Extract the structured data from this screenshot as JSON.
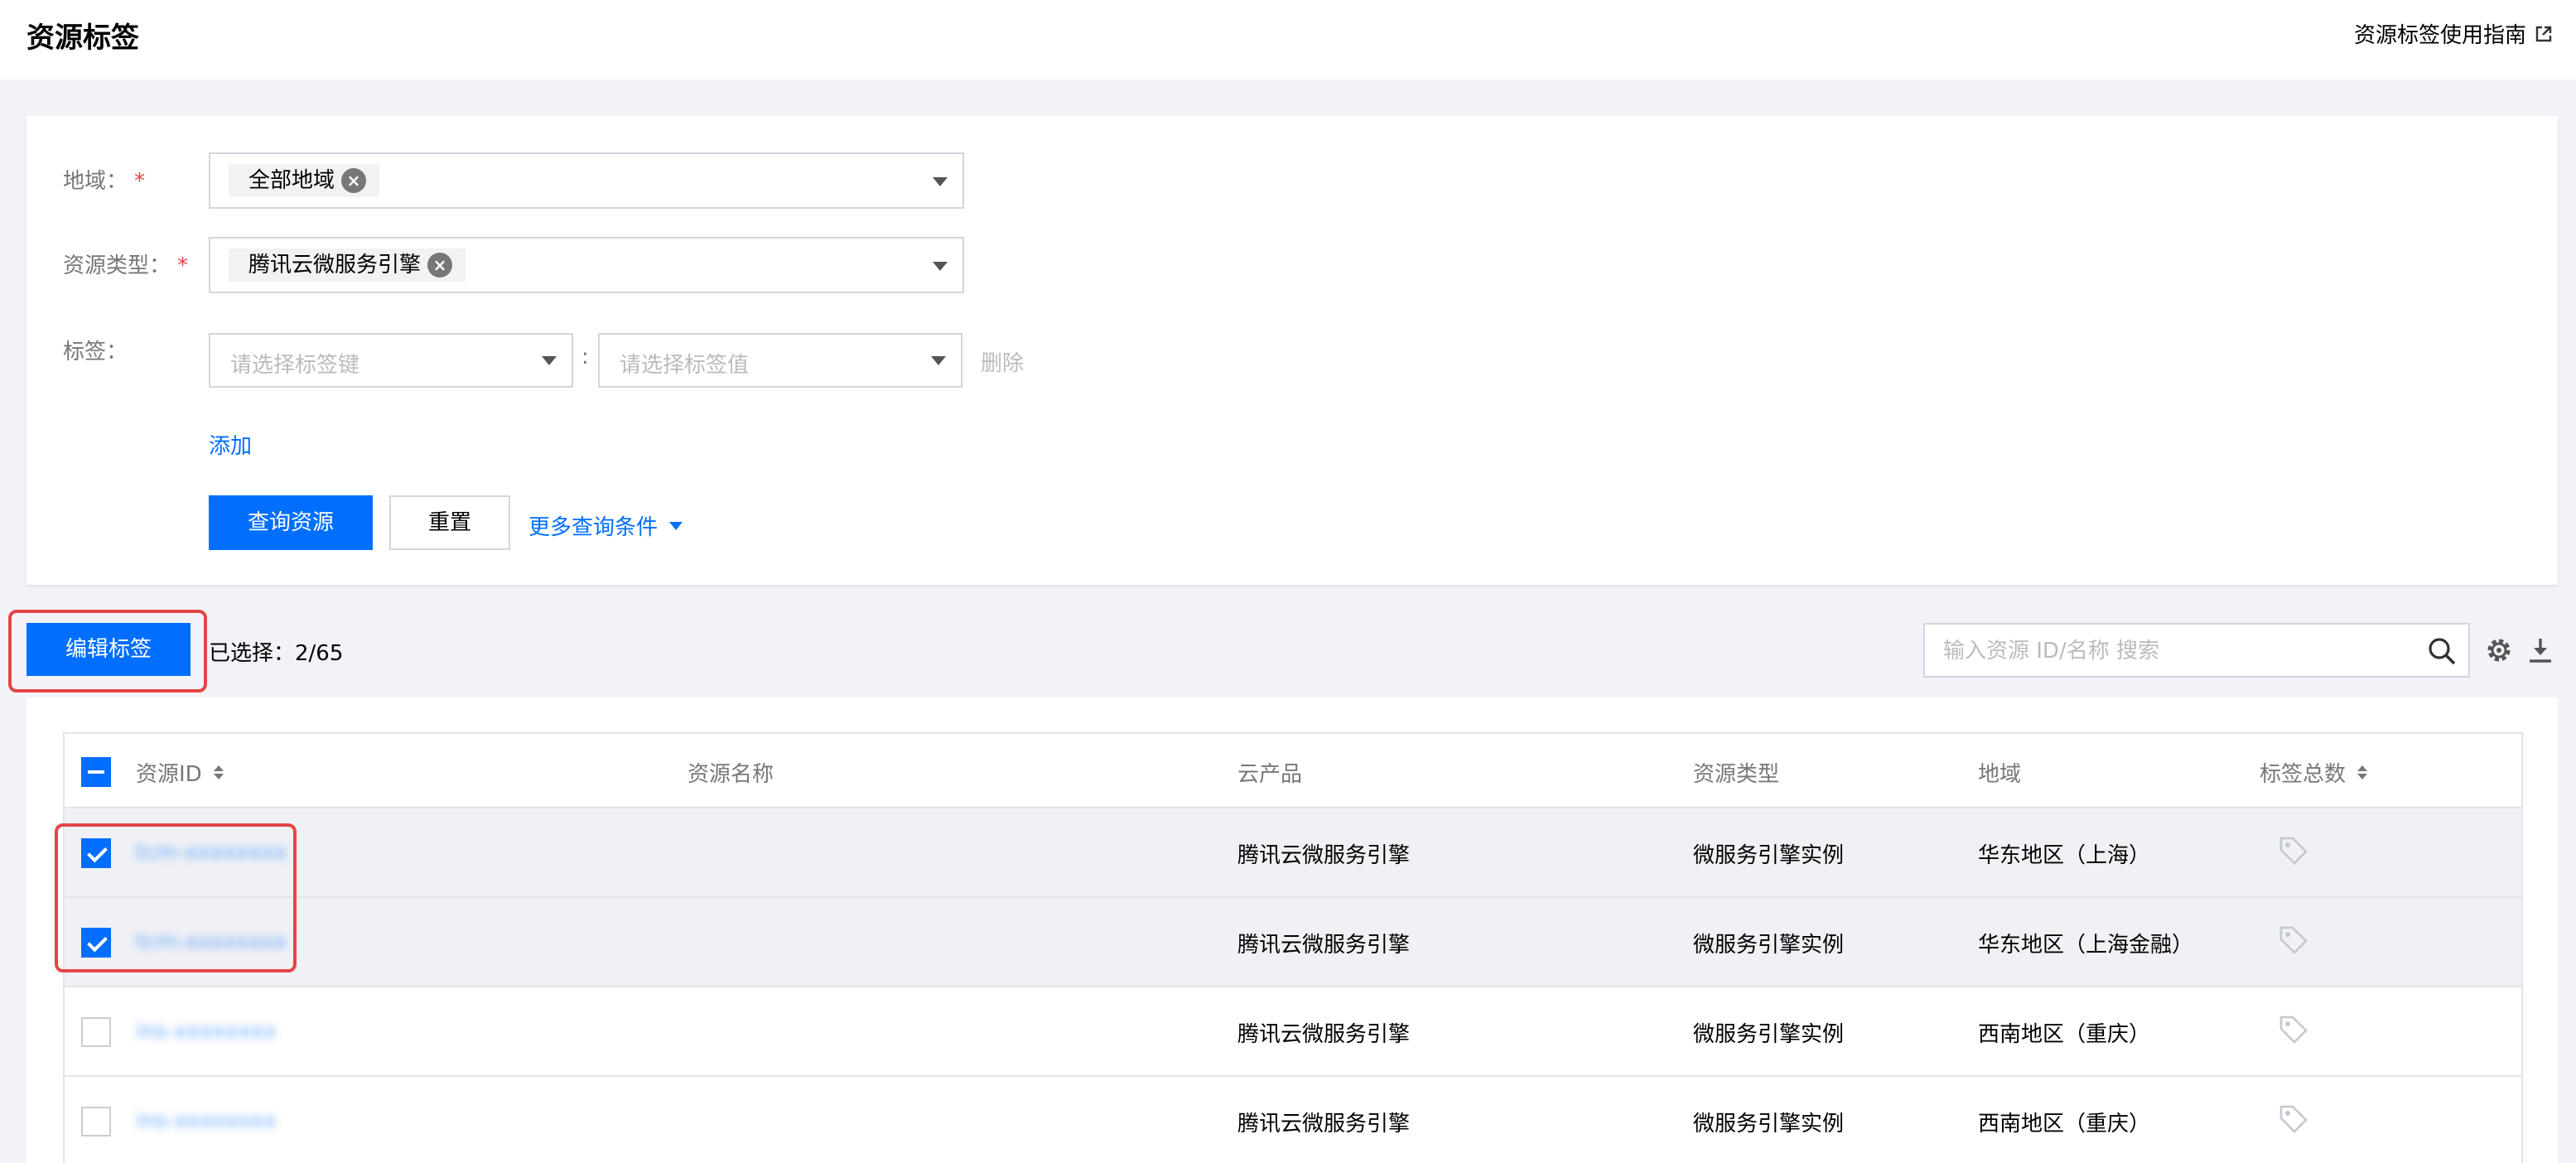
{
  "header": {
    "title": "资源标签",
    "guide_link": "资源标签使用指南"
  },
  "filters": {
    "region": {
      "label": "地域：",
      "required": "*",
      "selected": "全部地域"
    },
    "resource_type": {
      "label": "资源类型：",
      "required": "*",
      "selected": "腾讯云微服务引擎"
    },
    "tags": {
      "label": "标签：",
      "key_placeholder": "请选择标签键",
      "separator": ":",
      "value_placeholder": "请选择标签值",
      "delete": "删除"
    },
    "add": "添加",
    "query_button": "查询资源",
    "reset_button": "重置",
    "more_conditions": "更多查询条件"
  },
  "toolbar": {
    "edit_tags_button": "编辑标签",
    "selected_count": "已选择：2/65",
    "search_placeholder": "输入资源 ID/名称 搜索"
  },
  "table": {
    "columns": [
      "资源ID",
      "资源名称",
      "云产品",
      "资源类型",
      "地域",
      "标签总数"
    ],
    "rows": [
      {
        "checked": true,
        "id": "tcm-xxxxxxxx",
        "name": "",
        "product": "腾讯云微服务引擎",
        "type": "微服务引擎实例",
        "region": "华东地区（上海）"
      },
      {
        "checked": true,
        "id": "tcm-xxxxxxxx",
        "name": "",
        "product": "腾讯云微服务引擎",
        "type": "微服务引擎实例",
        "region": "华东地区（上海金融）"
      },
      {
        "checked": false,
        "id": "ins-xxxxxxxx",
        "name": "",
        "product": "腾讯云微服务引擎",
        "type": "微服务引擎实例",
        "region": "西南地区（重庆）"
      },
      {
        "checked": false,
        "id": "ins-xxxxxxxx",
        "name": "",
        "product": "腾讯云微服务引擎",
        "type": "微服务引擎实例",
        "region": "西南地区（重庆）"
      }
    ]
  },
  "colors": {
    "primary": "#006eff",
    "highlight": "#e54545"
  }
}
